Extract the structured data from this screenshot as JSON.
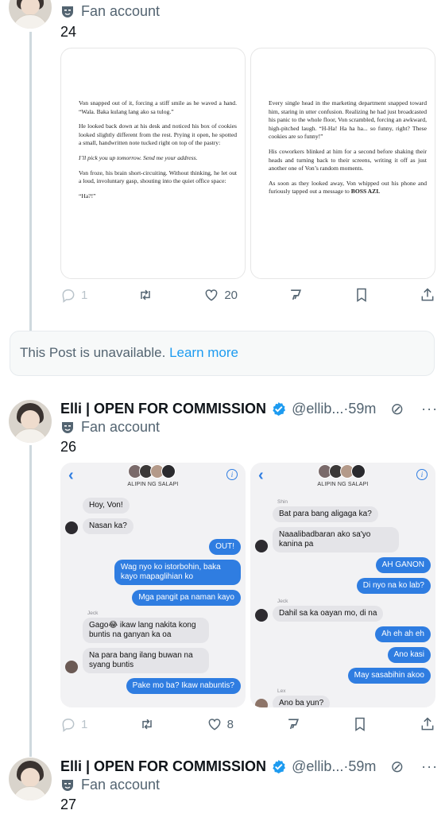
{
  "post24": {
    "fan_label": "Fan account",
    "number": "24",
    "page_left": [
      "Von snapped out of it, forcing a stiff smile as he waved a hand. “Wala. Baka kulang lang ako sa tulog.”",
      "He looked back down at his desk and noticed his box of cookies looked slightly different from the rest. Prying it open, he spotted a small, handwritten note tucked right on top of the pastry:",
      "I’ll pick you up tomorrow. Send me your address.",
      "Von froze, his brain short-circuiting. Without thinking, he let out a loud, involuntary gasp, shouting into the quiet office space:",
      "“Ha?!”"
    ],
    "page_right": [
      "Every single head in the marketing department snapped toward him, staring in utter confusion. Realizing he had just broadcasted his panic to the whole floor, Von scrambled, forcing an awkward, high-pitched laugh. “H-Ha! Ha ha ha... so funny, right? These cookies are so funny!”",
      "His coworkers blinked at him for a second before shaking their heads and turning back to their screens, writing it off as just another one of Von’s random moments."
    ],
    "page_right_last_prefix": "As soon as they looked away, Von whipped out his phone and furiously tapped out a message to ",
    "page_right_last_bold": "BOSS AZI.",
    "reply_count": "1",
    "like_count": "20"
  },
  "unavailable": {
    "text": "This Post is unavailable.",
    "link": "Learn more"
  },
  "post26": {
    "author_name": "Elli | OPEN FOR COMMISSION",
    "handle": "@ellib...",
    "time": "·59m",
    "fan_label": "Fan account",
    "number": "26",
    "group_name": "ALIPIN NG SALAPI",
    "chat_left": [
      {
        "dir": "in",
        "text": "Hoy, Von!"
      },
      {
        "dir": "in",
        "avatar": true,
        "text": "Nasan ka?"
      },
      {
        "dir": "out",
        "text": "OUT!"
      },
      {
        "dir": "out",
        "text": "Wag nyo ko istorbohin, baka kayo mapaglihian ko"
      },
      {
        "dir": "out",
        "text": "Mga pangit pa naman kayo"
      },
      {
        "dir": "in",
        "sender": "Jeck",
        "text": "Gago😂 ikaw lang nakita kong buntis na ganyan ka oa"
      },
      {
        "dir": "in",
        "avatar": true,
        "text": "Na para bang ilang buwan na syang buntis"
      },
      {
        "dir": "out",
        "text": "Pake mo ba? Ikaw nabuntis?"
      }
    ],
    "chat_right": [
      {
        "dir": "in",
        "sender": "Shin",
        "text": "Bat para bang aligaga ka?"
      },
      {
        "dir": "in",
        "avatar": true,
        "text": "Naaalibadbaran ako sa'yo kanina pa"
      },
      {
        "dir": "out",
        "text": "AH GANON"
      },
      {
        "dir": "out",
        "text": "Di nyo na ko lab?"
      },
      {
        "dir": "in",
        "sender": "Jeck",
        "avatar": true,
        "text": "Dahil sa ka oayan mo, di na"
      },
      {
        "dir": "out",
        "text": "Ah eh ah eh"
      },
      {
        "dir": "out",
        "text": "Ano kasi"
      },
      {
        "dir": "out",
        "text": "May sasabihin akoo"
      },
      {
        "dir": "in",
        "sender": "Lex",
        "avatar": true,
        "text": "Ano ba yun?"
      }
    ],
    "reply_count": "1",
    "like_count": "8"
  },
  "post27": {
    "author_name": "Elli | OPEN FOR COMMISSION",
    "handle": "@ellib...",
    "time": "·59m",
    "fan_label": "Fan account",
    "number": "27"
  },
  "colors": {
    "accent": "#1d9bf0",
    "imessage_blue": "#2f7de1",
    "muted": "#536471"
  },
  "icons": [
    "reply-icon",
    "retweet-icon",
    "like-icon",
    "grok-icon",
    "bookmark-icon",
    "share-icon",
    "verified-icon",
    "mask-icon",
    "more-icon"
  ]
}
